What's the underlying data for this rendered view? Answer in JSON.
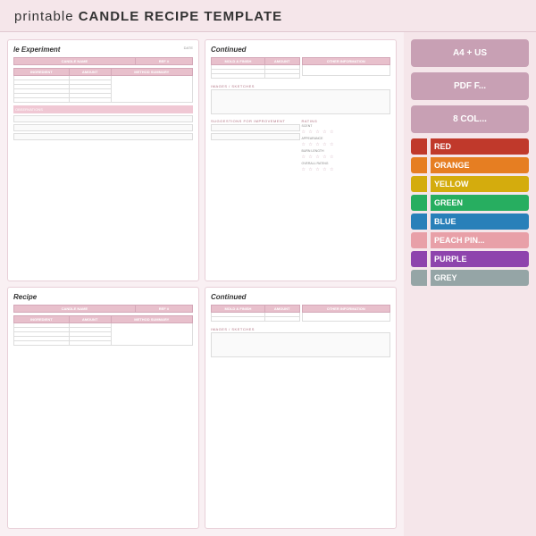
{
  "header": {
    "prefix": "printable ",
    "title": "CANDLE RECIPE TEMPLATE"
  },
  "info_panel": {
    "badge1_label": "A4 + US",
    "badge2_label": "PDF F...",
    "badge3_label": "8 COL..."
  },
  "colors": [
    {
      "id": "red",
      "label": "RED",
      "hex": "#c0392b"
    },
    {
      "id": "orange",
      "label": "ORANGE",
      "hex": "#e67e22"
    },
    {
      "id": "yellow",
      "label": "YELLOW",
      "hex": "#d4ac0d"
    },
    {
      "id": "green",
      "label": "GREEN",
      "hex": "#27ae60"
    },
    {
      "id": "blue",
      "label": "BLUE",
      "hex": "#2980b9"
    },
    {
      "id": "peach-pink",
      "label": "PEACH PIN...",
      "hex": "#e8a0a8"
    },
    {
      "id": "purple",
      "label": "PURPLE",
      "hex": "#8e44ad"
    },
    {
      "id": "grey",
      "label": "GREY",
      "hex": "#95a5a6"
    }
  ],
  "templates": [
    {
      "id": "card1",
      "title": "le Experiment",
      "date_label": "DATE",
      "candle_name_label": "CANDLE NAME",
      "ref_label": "REF #",
      "ingredient_label": "INGREDIENT",
      "amount_label": "AMOUNT",
      "method_label": "METHOD SUMMARY",
      "observations_label": "OBSERVATIONS"
    },
    {
      "id": "card2",
      "title": "Continued",
      "mold_label": "MOLD & FINISH",
      "amount_label": "AMOUNT",
      "other_label": "OTHER INFORMATION",
      "images_label": "IMAGES / SKETCHES",
      "suggestions_label": "SUGGESTIONS FOR IMPROVEMENT",
      "rating_label": "RATING",
      "scent_label": "SCENT",
      "appearance_label": "APPEARANCE",
      "burn_length_label": "BURN LENGTH",
      "overall_label": "OVERALL RATING",
      "stars": "☆ ☆ ☆ ☆ ☆"
    },
    {
      "id": "card3",
      "title": "Recipe",
      "candle_name_label": "CANDLE NAME",
      "ref_label": "REF #",
      "ingredient_label": "INGREDIENT",
      "amount_label": "AMOUNT",
      "method_label": "METHOD SUMMARY"
    },
    {
      "id": "card4",
      "title": "Continued",
      "mold_label": "MOLD & FINISH",
      "amount_label": "AMOUNT",
      "other_label": "OTHER INFORMATION",
      "images_label": "IMAGES / SKETCHES"
    }
  ]
}
